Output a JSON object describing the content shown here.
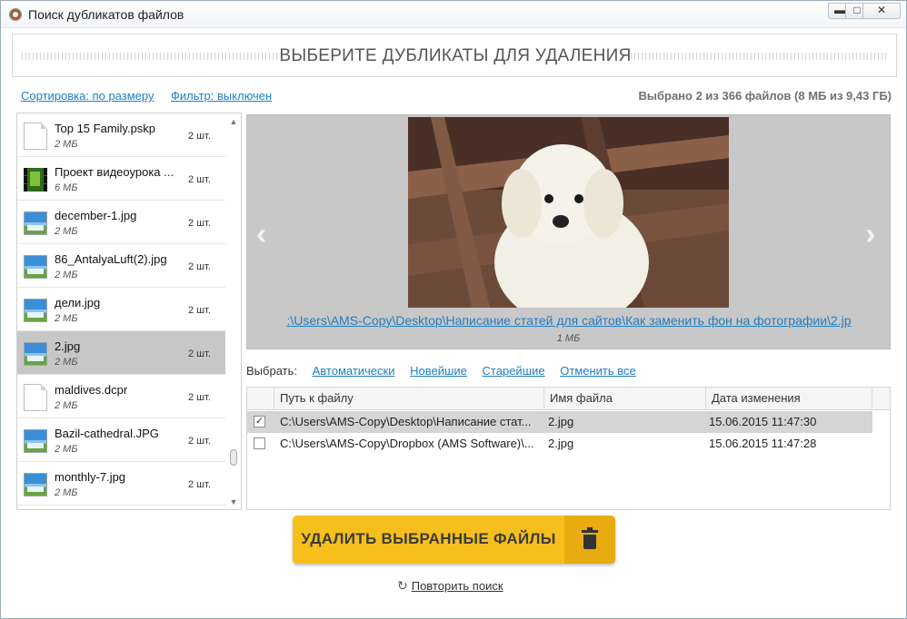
{
  "window": {
    "title": "Поиск дубликатов файлов",
    "min_glyph": "▬",
    "max_glyph": "□",
    "close_glyph": "✕"
  },
  "header": {
    "title": "ВЫБЕРИТЕ ДУБЛИКАТЫ ДЛЯ УДАЛЕНИЯ"
  },
  "toolbar": {
    "sort_label": "Сортировка: по размеру",
    "filter_label": "Фильтр: выключен",
    "summary": "Выбрано 2 из 366 файлов (8 МБ из 9,43 ГБ)"
  },
  "files": [
    {
      "name": "Top 15 Family.pskp",
      "size": "2 МБ",
      "count": "2 шт.",
      "icon": "document-icon",
      "selected": false
    },
    {
      "name": "Проект видеоурока ...",
      "size": "6 МБ",
      "count": "2 шт.",
      "icon": "video-file-icon",
      "selected": false
    },
    {
      "name": "december-1.jpg",
      "size": "2 МБ",
      "count": "2 шт.",
      "icon": "image-file-icon",
      "selected": false
    },
    {
      "name": "86_AntalyaLuft(2).jpg",
      "size": "2 МБ",
      "count": "2 шт.",
      "icon": "image-file-icon",
      "selected": false
    },
    {
      "name": "дели.jpg",
      "size": "2 МБ",
      "count": "2 шт.",
      "icon": "image-file-icon",
      "selected": false
    },
    {
      "name": "2.jpg",
      "size": "2 МБ",
      "count": "2 шт.",
      "icon": "image-file-icon",
      "selected": true
    },
    {
      "name": "maldives.dcpr",
      "size": "2 МБ",
      "count": "2 шт.",
      "icon": "document-icon",
      "selected": false
    },
    {
      "name": "Bazil-cathedral.JPG",
      "size": "2 МБ",
      "count": "2 шт.",
      "icon": "image-file-icon",
      "selected": false
    },
    {
      "name": "monthly-7.jpg",
      "size": "2 МБ",
      "count": "2 шт.",
      "icon": "image-file-icon",
      "selected": false
    }
  ],
  "preview": {
    "path": ":\\Users\\AMS-Copy\\Desktop\\Написание статей для сайтов\\Как заменить фон на фотографии\\2.jp",
    "size": "1 МБ",
    "prev_glyph": "‹",
    "next_glyph": "›"
  },
  "select": {
    "label": "Выбрать:",
    "auto": "Автоматически",
    "newest": "Новейшие",
    "oldest": "Старейшие",
    "cancel_all": "Отменить все"
  },
  "table": {
    "headers": [
      "Путь к файлу",
      "Имя файла",
      "Дата изменения"
    ],
    "rows": [
      {
        "checked": true,
        "path": "C:\\Users\\AMS-Copy\\Desktop\\Написание стат...",
        "name": "2.jpg",
        "date": "15.06.2015 11:47:30"
      },
      {
        "checked": false,
        "path": "C:\\Users\\AMS-Copy\\Dropbox (AMS Software)\\...",
        "name": "2.jpg",
        "date": "15.06.2015 11:47:28"
      }
    ]
  },
  "actions": {
    "delete_label": "УДАЛИТЬ ВЫБРАННЫЕ ФАЙЛЫ",
    "retry_label": "Повторить поиск",
    "retry_glyph": "↻"
  },
  "colors": {
    "accent_button": "#f6bf1c",
    "link": "#1f7ec0",
    "selected_row": "#c7c7c7"
  }
}
